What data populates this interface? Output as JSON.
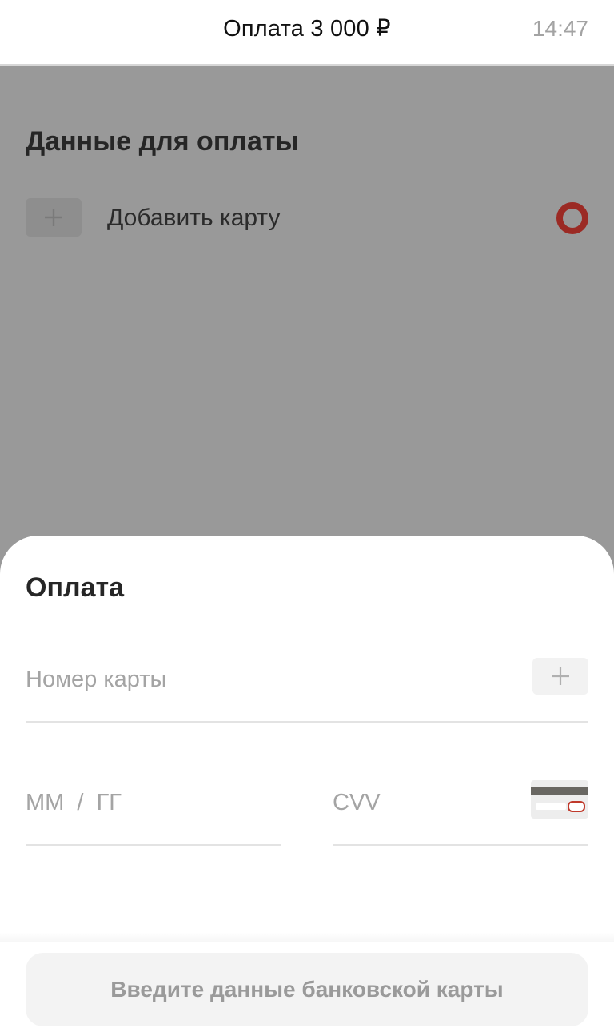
{
  "header": {
    "title": "Оплата 3 000  ₽",
    "time": "14:47"
  },
  "background_page": {
    "section_title": "Данные для оплаты",
    "add_card_label": "Добавить карту",
    "radio_color": "#9b2a24"
  },
  "sheet": {
    "title": "Оплата",
    "card_number": {
      "value": "",
      "placeholder": "Номер карты"
    },
    "expiry": {
      "value": "",
      "placeholder": "ММ  /  ГГ"
    },
    "cvv": {
      "value": "",
      "placeholder": "CVV"
    },
    "submit_label": "Введите данные банковской карты"
  },
  "icons": [
    "plus-icon",
    "scan-card-plus-icon",
    "cvv-card-icon"
  ]
}
